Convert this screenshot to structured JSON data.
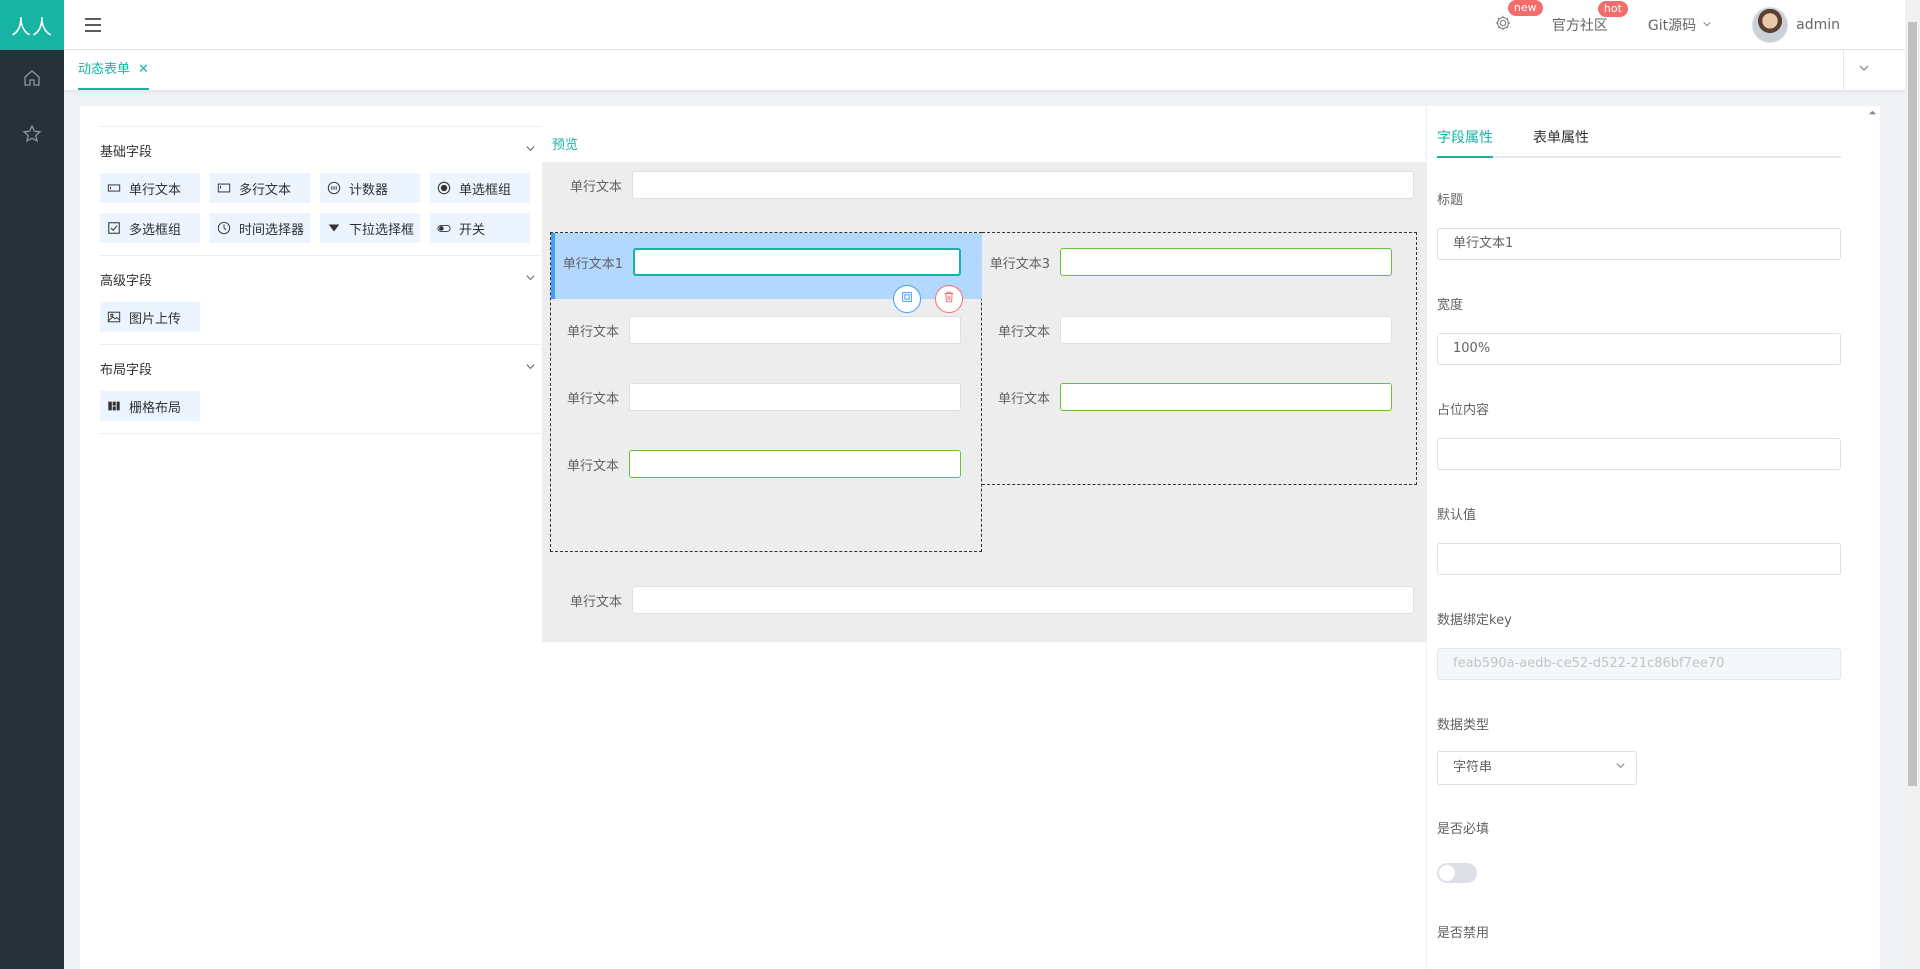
{
  "app": {
    "logo_text": "人人"
  },
  "topbar": {
    "settings_badge": "new",
    "community_label": "官方社区",
    "community_badge": "hot",
    "git_label": "Git源码",
    "user_name": "admin"
  },
  "tabs": [
    {
      "label": "动态表单",
      "close": "✕"
    }
  ],
  "widgets": {
    "groups": [
      {
        "title": "基础字段",
        "items": [
          "单行文本",
          "多行文本",
          "计数器",
          "单选框组",
          "多选框组",
          "时间选择器",
          "下拉选择框",
          "开关"
        ]
      },
      {
        "title": "高级字段",
        "items": [
          "图片上传"
        ]
      },
      {
        "title": "布局字段",
        "items": [
          "栅格布局"
        ]
      }
    ]
  },
  "preview": {
    "link": "预览",
    "top_field_label": "单行文本",
    "bottom_field_label": "单行文本",
    "grid": {
      "left": [
        "单行文本1",
        "单行文本",
        "单行文本",
        "单行文本"
      ],
      "right": [
        "单行文本3",
        "单行文本",
        "单行文本"
      ]
    }
  },
  "props": {
    "tabs": [
      "字段属性",
      "表单属性"
    ],
    "title_label": "标题",
    "title_value": "单行文本1",
    "width_label": "宽度",
    "width_value": "100%",
    "placeholder_label": "占位内容",
    "default_label": "默认值",
    "key_label": "数据绑定key",
    "key_value": "feab590a-aedb-ce52-d522-21c86bf7ee70",
    "type_label": "数据类型",
    "type_value": "字符串",
    "required_label": "是否必填",
    "required": false,
    "disabled_label": "是否禁用"
  },
  "colors": {
    "brand": "#17b3a3",
    "sidebar": "#263238",
    "selected": "#b3d8ff",
    "danger": "#f56c6c",
    "primary": "#409eff"
  }
}
